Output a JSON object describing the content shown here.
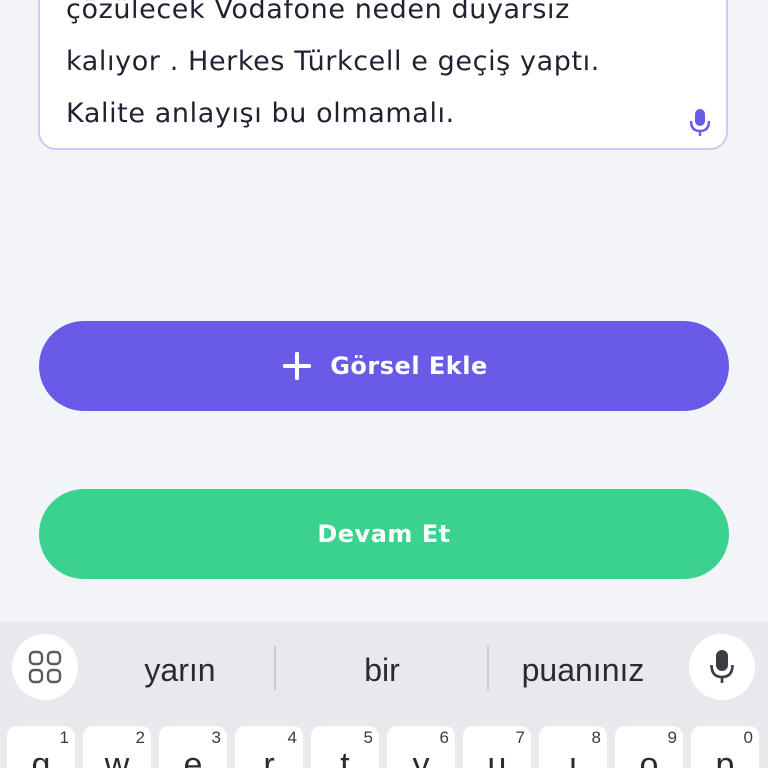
{
  "complaint": {
    "lines": [
      "çözülecek Vodafone neden duyarsız",
      "kalıyor . Herkes Türkcell e geçiş yaptı.",
      "Kalite anlayışı bu olmamalı."
    ]
  },
  "buttons": {
    "add_image": "Görsel Ekle",
    "continue": "Devam Et"
  },
  "keyboard": {
    "suggestions": [
      "yarın",
      "bir",
      "puanınız"
    ],
    "row1": [
      {
        "letter": "q",
        "num": "1"
      },
      {
        "letter": "w",
        "num": "2"
      },
      {
        "letter": "e",
        "num": "3"
      },
      {
        "letter": "r",
        "num": "4"
      },
      {
        "letter": "t",
        "num": "5"
      },
      {
        "letter": "y",
        "num": "6"
      },
      {
        "letter": "u",
        "num": "7"
      },
      {
        "letter": "ı",
        "num": "8"
      },
      {
        "letter": "o",
        "num": "9"
      },
      {
        "letter": "p",
        "num": "0"
      }
    ]
  },
  "colors": {
    "primary_purple": "#6a5ae8",
    "primary_green": "#3bd18e",
    "background": "#f3f4f8",
    "keyboard_bg": "#e8e9ed"
  }
}
